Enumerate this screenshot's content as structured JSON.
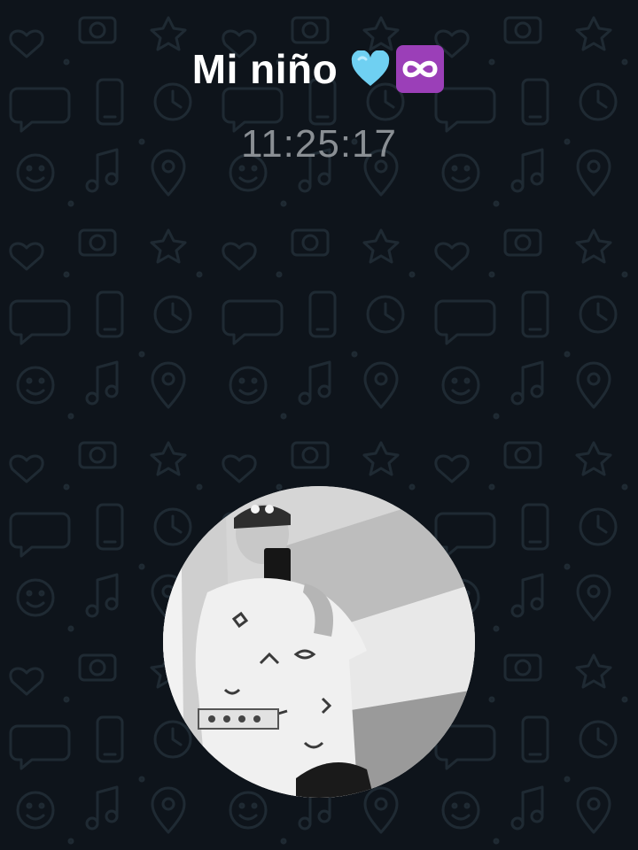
{
  "call": {
    "contact_name": "Mi niño",
    "name_emojis": [
      "light-blue-heart-icon",
      "infinity-icon"
    ],
    "timer": "11:25:17"
  },
  "avatar": {
    "description_icon": "profile-photo",
    "tone": "grayscale"
  },
  "colors": {
    "background": "#0e141b",
    "wallpaper_doodle": "#1f2a33",
    "name_text": "#ffffff",
    "timer_text": "#8a8f94",
    "heart": "#6fd0f2",
    "infinity_bg": "#9b3fb8"
  }
}
